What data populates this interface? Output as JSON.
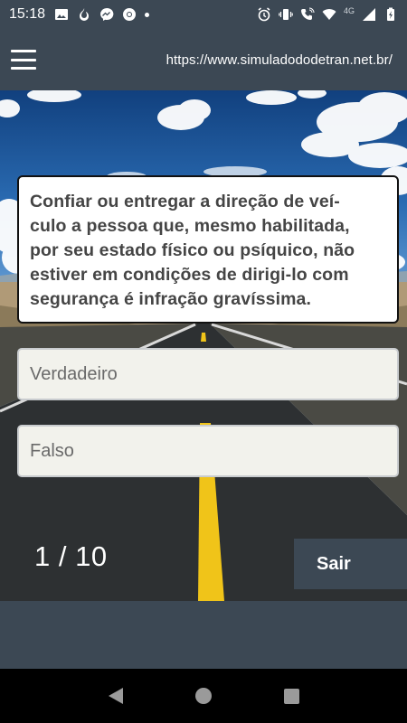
{
  "status_bar": {
    "time": "15:18",
    "network_label": "4G",
    "left_icons": [
      "image-icon",
      "fire-icon",
      "messenger-icon",
      "chrome-icon",
      "dot-icon"
    ],
    "right_icons": [
      "alarm-icon",
      "vibrate-icon",
      "wifi-call-icon",
      "wifi-icon",
      "signal-icon",
      "battery-icon"
    ]
  },
  "app_bar": {
    "menu_icon": "hamburger-menu-icon",
    "url": "https://www.simuladododetran.net.br/"
  },
  "quiz": {
    "question": "Confiar ou entregar a direção de veí-culo a pessoa que, mesmo habilitada, por seu estado físico ou psíquico, não estiver em condições de dirigi-lo com segurança é infração gravíssima.",
    "question_lines": [
      "Confiar ou entregar a direção de veí-",
      "culo a pessoa que, mesmo habilitada,",
      "por seu estado físico ou psíquico, não",
      "estiver em condições de dirigi-lo com",
      "segurança é infração gravíssima."
    ],
    "options": [
      "Verdadeiro",
      "Falso"
    ],
    "counter": "1 / 10",
    "exit_label": "Sair"
  },
  "nav_bar": {
    "icons": [
      "back-icon",
      "home-icon",
      "recents-icon"
    ]
  },
  "colors": {
    "bar": "#3c4854",
    "card": "#ffffff",
    "option": "#f2f2ec",
    "text_dark": "#454545",
    "road_line": "#f0c419"
  }
}
